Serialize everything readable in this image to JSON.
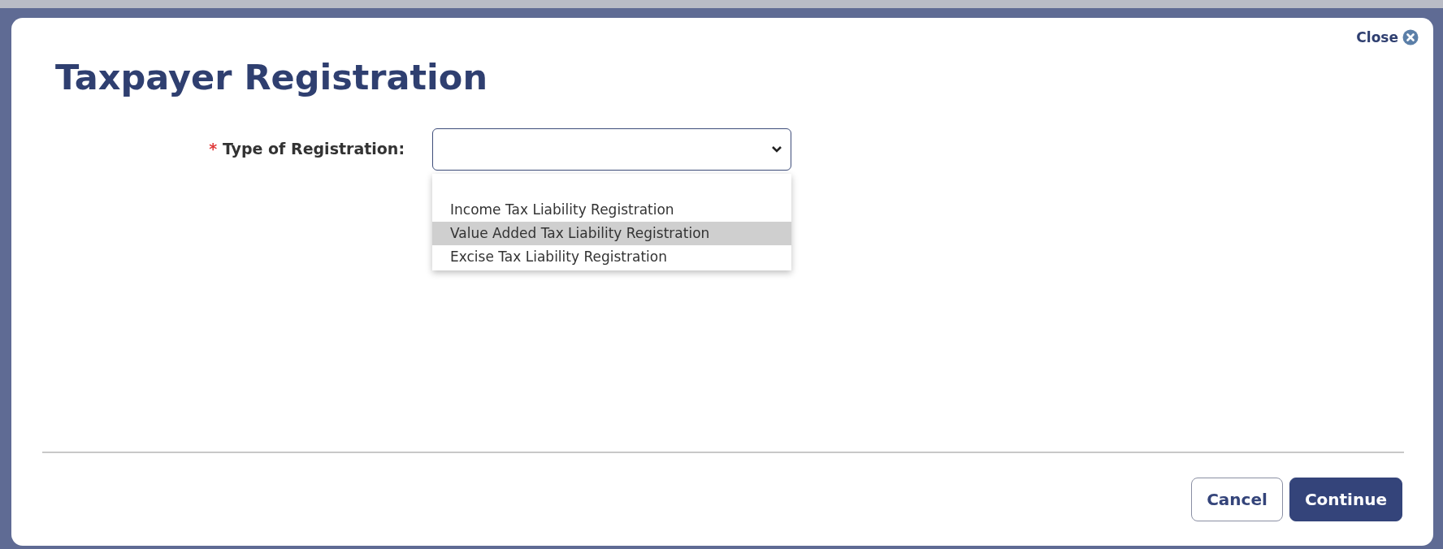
{
  "dialog": {
    "title": "Taxpayer Registration",
    "close_label": "Close"
  },
  "form": {
    "required_mark": "*",
    "label": "Type of Registration:",
    "options": [
      {
        "label": "Income Tax Liability Registration",
        "selected": false
      },
      {
        "label": "Value Added Tax Liability Registration",
        "selected": true
      },
      {
        "label": "Excise Tax Liability Registration",
        "selected": false
      }
    ]
  },
  "buttons": [
    {
      "label": "Cancel",
      "kind": "secondary"
    },
    {
      "label": "Continue",
      "kind": "primary"
    }
  ]
}
